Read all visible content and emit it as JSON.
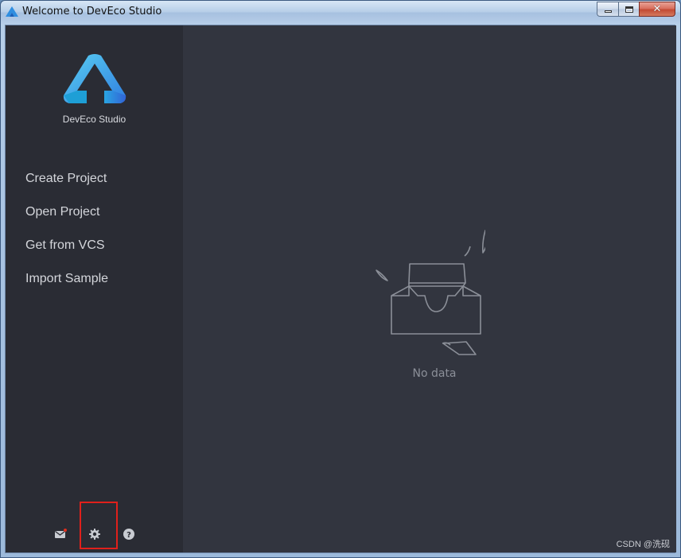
{
  "window": {
    "title": "Welcome to DevEco Studio",
    "controls": {
      "minimize": "",
      "maximize": "",
      "close": "✕"
    }
  },
  "sidebar": {
    "app_name": "DevEco Studio",
    "menu": [
      {
        "label": "Create Project"
      },
      {
        "label": "Open Project"
      },
      {
        "label": "Get from VCS"
      },
      {
        "label": "Import Sample"
      }
    ],
    "bottom_icons": [
      "mail-icon",
      "gear-icon",
      "help-icon"
    ]
  },
  "main": {
    "empty_text": "No data"
  },
  "watermark": "CSDN @洗砚",
  "colors": {
    "sidebar_bg": "#2a2c34",
    "main_bg": "#32353f",
    "highlight": "#e0201b",
    "logo_light": "#3fb6e6",
    "logo_dark": "#2a5fd0"
  }
}
